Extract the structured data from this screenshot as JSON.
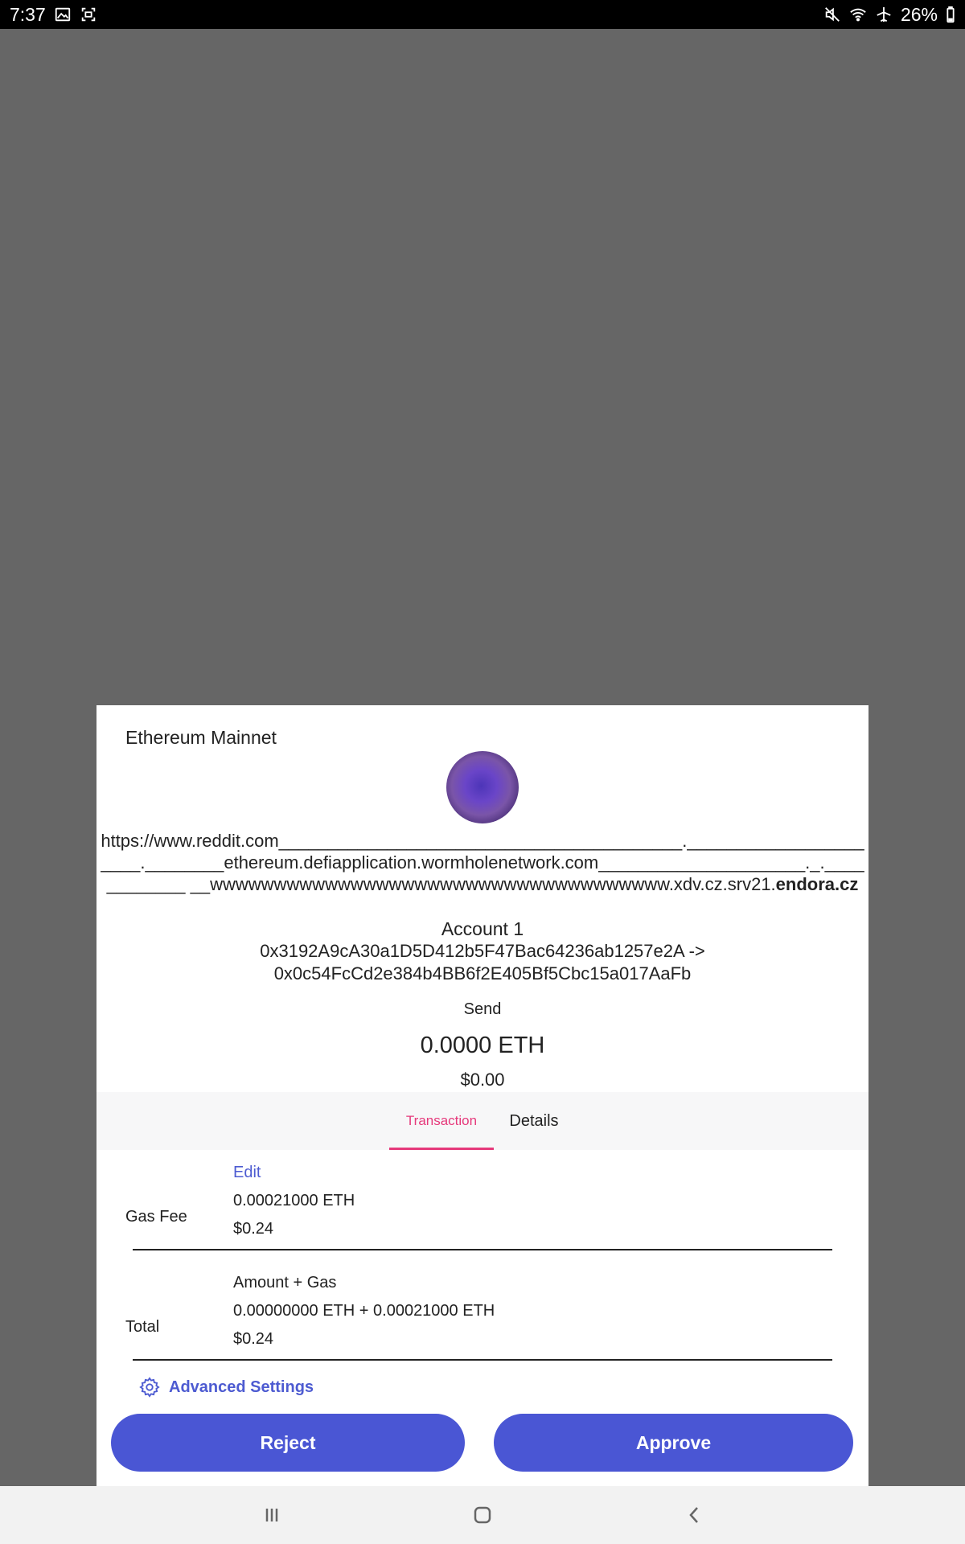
{
  "status_bar": {
    "time": "7:37",
    "battery": "26%",
    "icons": [
      "image-icon",
      "screenshot-icon",
      "mute-icon",
      "wifi-icon",
      "airplane-icon",
      "battery-icon"
    ]
  },
  "dialog": {
    "network": "Ethereum Mainnet",
    "origin_prefix": "https://www.reddit.com_________________________________________.______________________.________ethereum.defiapplication.wormholenetwork.com_____________________._.____________ __wwwwwwwwwwwwwwwwwwwwwwwwwwwwwwwwwwww.xdv.cz.srv21.",
    "origin_domain": "endora.cz",
    "account_name": "Account 1",
    "from_address": "0x3192A9cA30a1D5D412b5F47Bac64236ab1257e2A ->",
    "to_address": "0x0c54FcCd2e384b4BB6f2E405Bf5Cbc15a017AaFb",
    "action": "Send",
    "amount_eth": "0.0000 ETH",
    "amount_usd": "$0.00"
  },
  "tabs": {
    "transaction": "Transaction",
    "details": "Details",
    "active": "Transaction",
    "active_color": "#e6397b"
  },
  "gas": {
    "label": "Gas Fee",
    "edit": "Edit",
    "eth": "0.00021000 ETH",
    "usd": "$0.24"
  },
  "total": {
    "label": "Total",
    "caption": "Amount + Gas",
    "eth": "0.00000000 ETH + 0.00021000 ETH",
    "usd": "$0.24"
  },
  "advanced_settings": "Advanced Settings",
  "buttons": {
    "reject": "Reject",
    "approve": "Approve",
    "color": "#4a56d4"
  },
  "nav": {
    "icons": [
      "recents-icon",
      "home-icon",
      "back-icon"
    ]
  }
}
